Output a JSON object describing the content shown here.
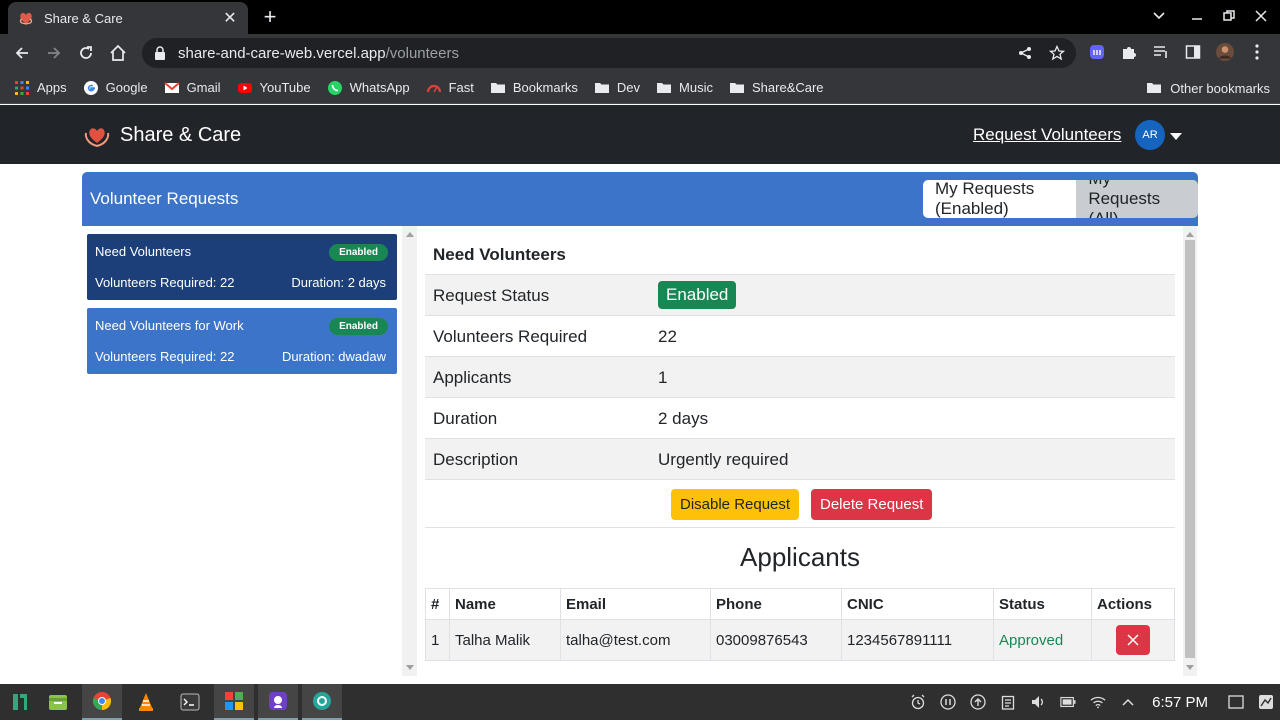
{
  "browser": {
    "tab_title": "Share & Care",
    "url_host": "share-and-care-web.vercel.app",
    "url_path": "/volunteers",
    "bookmarks": [
      "Apps",
      "Google",
      "Gmail",
      "YouTube",
      "WhatsApp",
      "Fast",
      "Bookmarks",
      "Dev",
      "Music",
      "Share&Care"
    ],
    "other_bookmarks": "Other bookmarks"
  },
  "nav": {
    "brand": "Share & Care",
    "request_link": "Request Volunteers",
    "avatar_initials": "AR"
  },
  "header": {
    "title": "Volunteer Requests",
    "btn_enabled": "My Requests (Enabled)",
    "btn_all": "My Requests (All)"
  },
  "requests": [
    {
      "title": "Need Volunteers",
      "badge": "Enabled",
      "volunteers": "Volunteers Required: 22",
      "duration": "Duration: 2 days"
    },
    {
      "title": "Need Volunteers for Work",
      "badge": "Enabled",
      "volunteers": "Volunteers Required: 22",
      "duration": "Duration: dwadaw"
    }
  ],
  "detail": {
    "name": "Need Volunteers",
    "rows": [
      {
        "label": "Request Status",
        "value": "Enabled"
      },
      {
        "label": "Volunteers Required",
        "value": "22"
      },
      {
        "label": "Applicants",
        "value": "1"
      },
      {
        "label": "Duration",
        "value": "2 days"
      },
      {
        "label": "Description",
        "value": "Urgently required"
      }
    ],
    "disable_btn": "Disable Request",
    "delete_btn": "Delete Request",
    "applicants_heading": "Applicants"
  },
  "applicants_table": {
    "headers": [
      "#",
      "Name",
      "Email",
      "Phone",
      "CNIC",
      "Status",
      "Actions"
    ],
    "rows": [
      {
        "num": "1",
        "name": "Talha Malik",
        "email": "talha@test.com",
        "phone": "03009876543",
        "cnic": "1234567891111",
        "status": "Approved"
      }
    ]
  },
  "taskbar": {
    "time": "6:57 PM"
  },
  "colors": {
    "primary": "#3c74c9",
    "primary_dark": "#1c3f7a",
    "success": "#198754",
    "warning": "#ffc107",
    "danger": "#dc3545",
    "navbar": "#212529"
  }
}
